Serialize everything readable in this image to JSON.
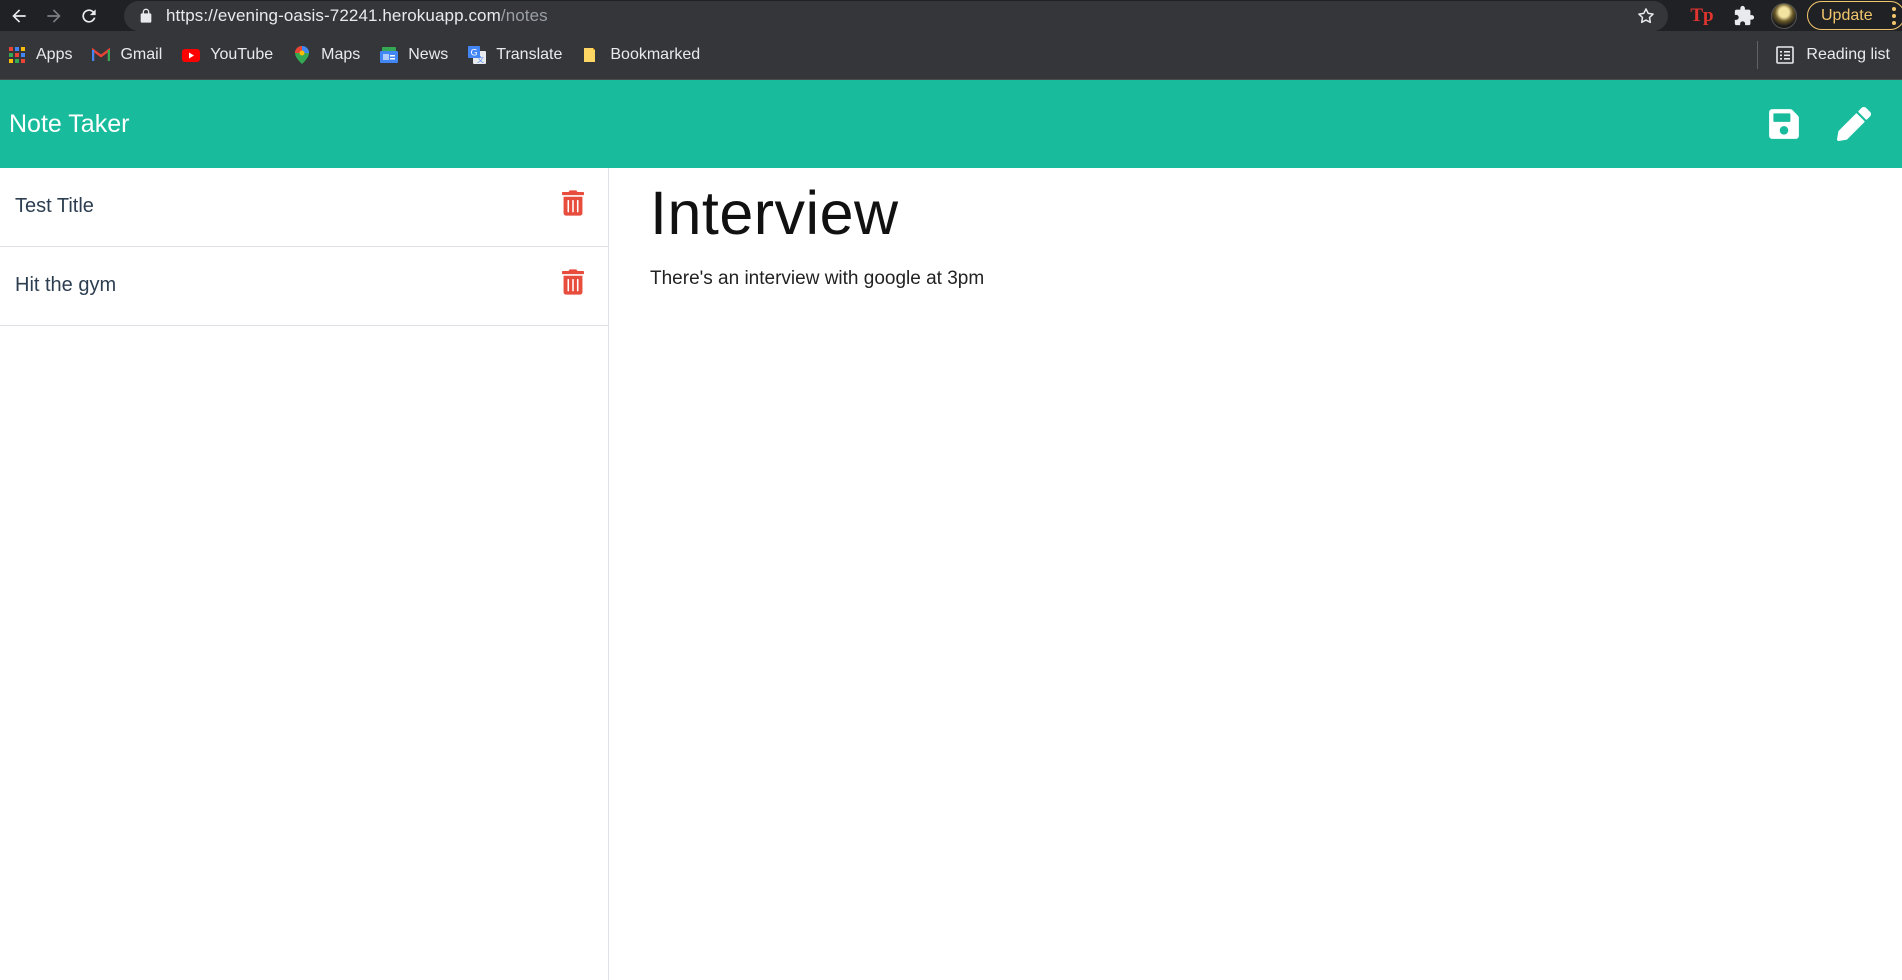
{
  "browser": {
    "url_domain": "https://evening-oasis-72241.herokuapp.com",
    "url_path": "/notes",
    "extension_label": "Tp",
    "update_label": "Update",
    "icons": {
      "back": "back-arrow-icon",
      "forward": "forward-arrow-icon",
      "reload": "reload-icon",
      "lock": "lock-icon",
      "star": "star-icon",
      "extensions": "puzzle-icon"
    },
    "colors": {
      "chrome_dark": "#202124",
      "omnibox": "#35363a",
      "update_accent": "#f2c66d"
    }
  },
  "bookmarks": {
    "items": [
      {
        "label": "Apps",
        "icon": "apps-grid-icon"
      },
      {
        "label": "Gmail",
        "icon": "gmail-icon"
      },
      {
        "label": "YouTube",
        "icon": "youtube-icon"
      },
      {
        "label": "Maps",
        "icon": "maps-pin-icon"
      },
      {
        "label": "News",
        "icon": "news-icon"
      },
      {
        "label": "Translate",
        "icon": "translate-icon"
      },
      {
        "label": "Bookmarked",
        "icon": "folder-icon"
      }
    ],
    "reading_list_label": "Reading list"
  },
  "navbar": {
    "title": "Note Taker",
    "save_icon": "save-icon",
    "edit_icon": "pencil-icon",
    "color": "#18bc9c"
  },
  "notes": [
    {
      "title": "Test Title",
      "delete_icon": "trash-icon"
    },
    {
      "title": "Hit the gym",
      "delete_icon": "trash-icon"
    }
  ],
  "active_note": {
    "title": "Interview",
    "text": "There's an interview with google at 3pm"
  },
  "accent_colors": {
    "delete": "#e74c3c",
    "text": "#2c3e50"
  }
}
